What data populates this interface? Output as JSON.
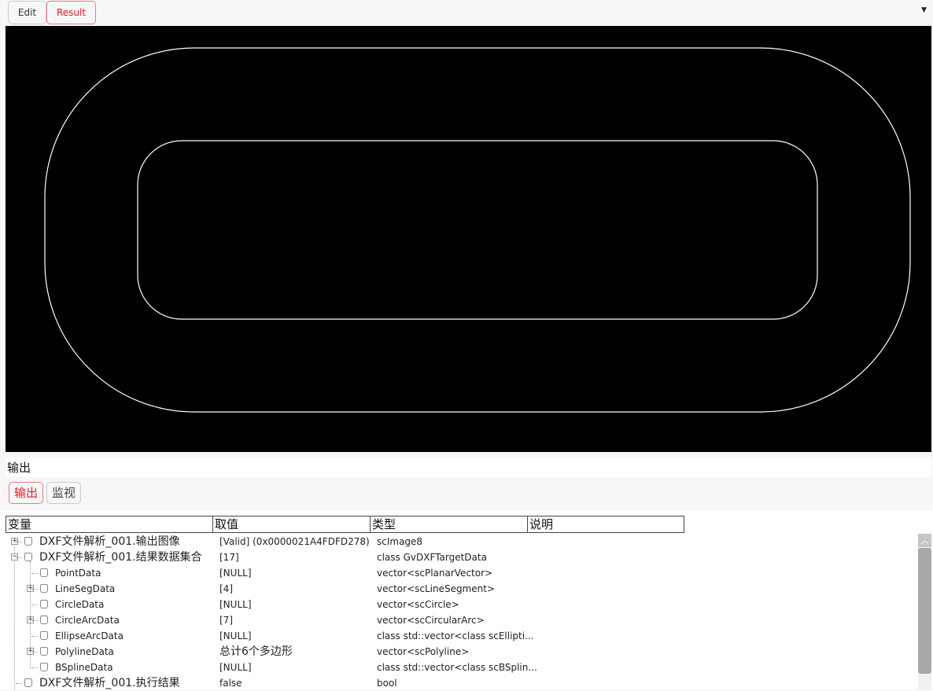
{
  "tabs": [
    {
      "label": "Edit",
      "active": false
    },
    {
      "label": "Result",
      "active": true
    }
  ],
  "dropdown_icon": "triangle-down-icon",
  "output_section": {
    "title": "输出"
  },
  "bottom_tabs": [
    {
      "label": "输出",
      "active": true
    },
    {
      "label": "监视",
      "active": false
    }
  ],
  "grid": {
    "columns": [
      "变量",
      "取值",
      "类型",
      "说明"
    ],
    "rows": [
      {
        "name": "DXF文件解析_001.输出图像",
        "value": "[Valid] (0x0000021A4FDFD278)",
        "type": "scImage8",
        "desc": "",
        "level": 0,
        "expander": "+"
      },
      {
        "name": "DXF文件解析_001.结果数据集合",
        "value": "[17]",
        "type": "class GvDXFTargetData",
        "desc": "",
        "level": 0,
        "expander": "-"
      },
      {
        "name": "PointData",
        "value": "[NULL]",
        "type": "vector<scPlanarVector>",
        "desc": "",
        "level": 1,
        "expander": ""
      },
      {
        "name": "LineSegData",
        "value": "[4]",
        "type": "vector<scLineSegment>",
        "desc": "",
        "level": 1,
        "expander": "+"
      },
      {
        "name": "CircleData",
        "value": "[NULL]",
        "type": "vector<scCircle>",
        "desc": "",
        "level": 1,
        "expander": ""
      },
      {
        "name": "CircleArcData",
        "value": "[7]",
        "type": "vector<scCircularArc>",
        "desc": "",
        "level": 1,
        "expander": "+"
      },
      {
        "name": "EllipseArcData",
        "value": "[NULL]",
        "type": "class std::vector<class scEllipti...",
        "desc": "",
        "level": 1,
        "expander": ""
      },
      {
        "name": "PolylineData",
        "value": "总计6个多边形",
        "type": "vector<scPolyline>",
        "desc": "",
        "level": 1,
        "expander": "+"
      },
      {
        "name": "BSplineData",
        "value": "[NULL]",
        "type": "class std::vector<class scBSplin...",
        "desc": "",
        "level": 1,
        "expander": ""
      },
      {
        "name": "DXF文件解析_001.执行结果",
        "value": "false",
        "type": "bool",
        "desc": "",
        "level": 0,
        "expander": ""
      }
    ]
  }
}
